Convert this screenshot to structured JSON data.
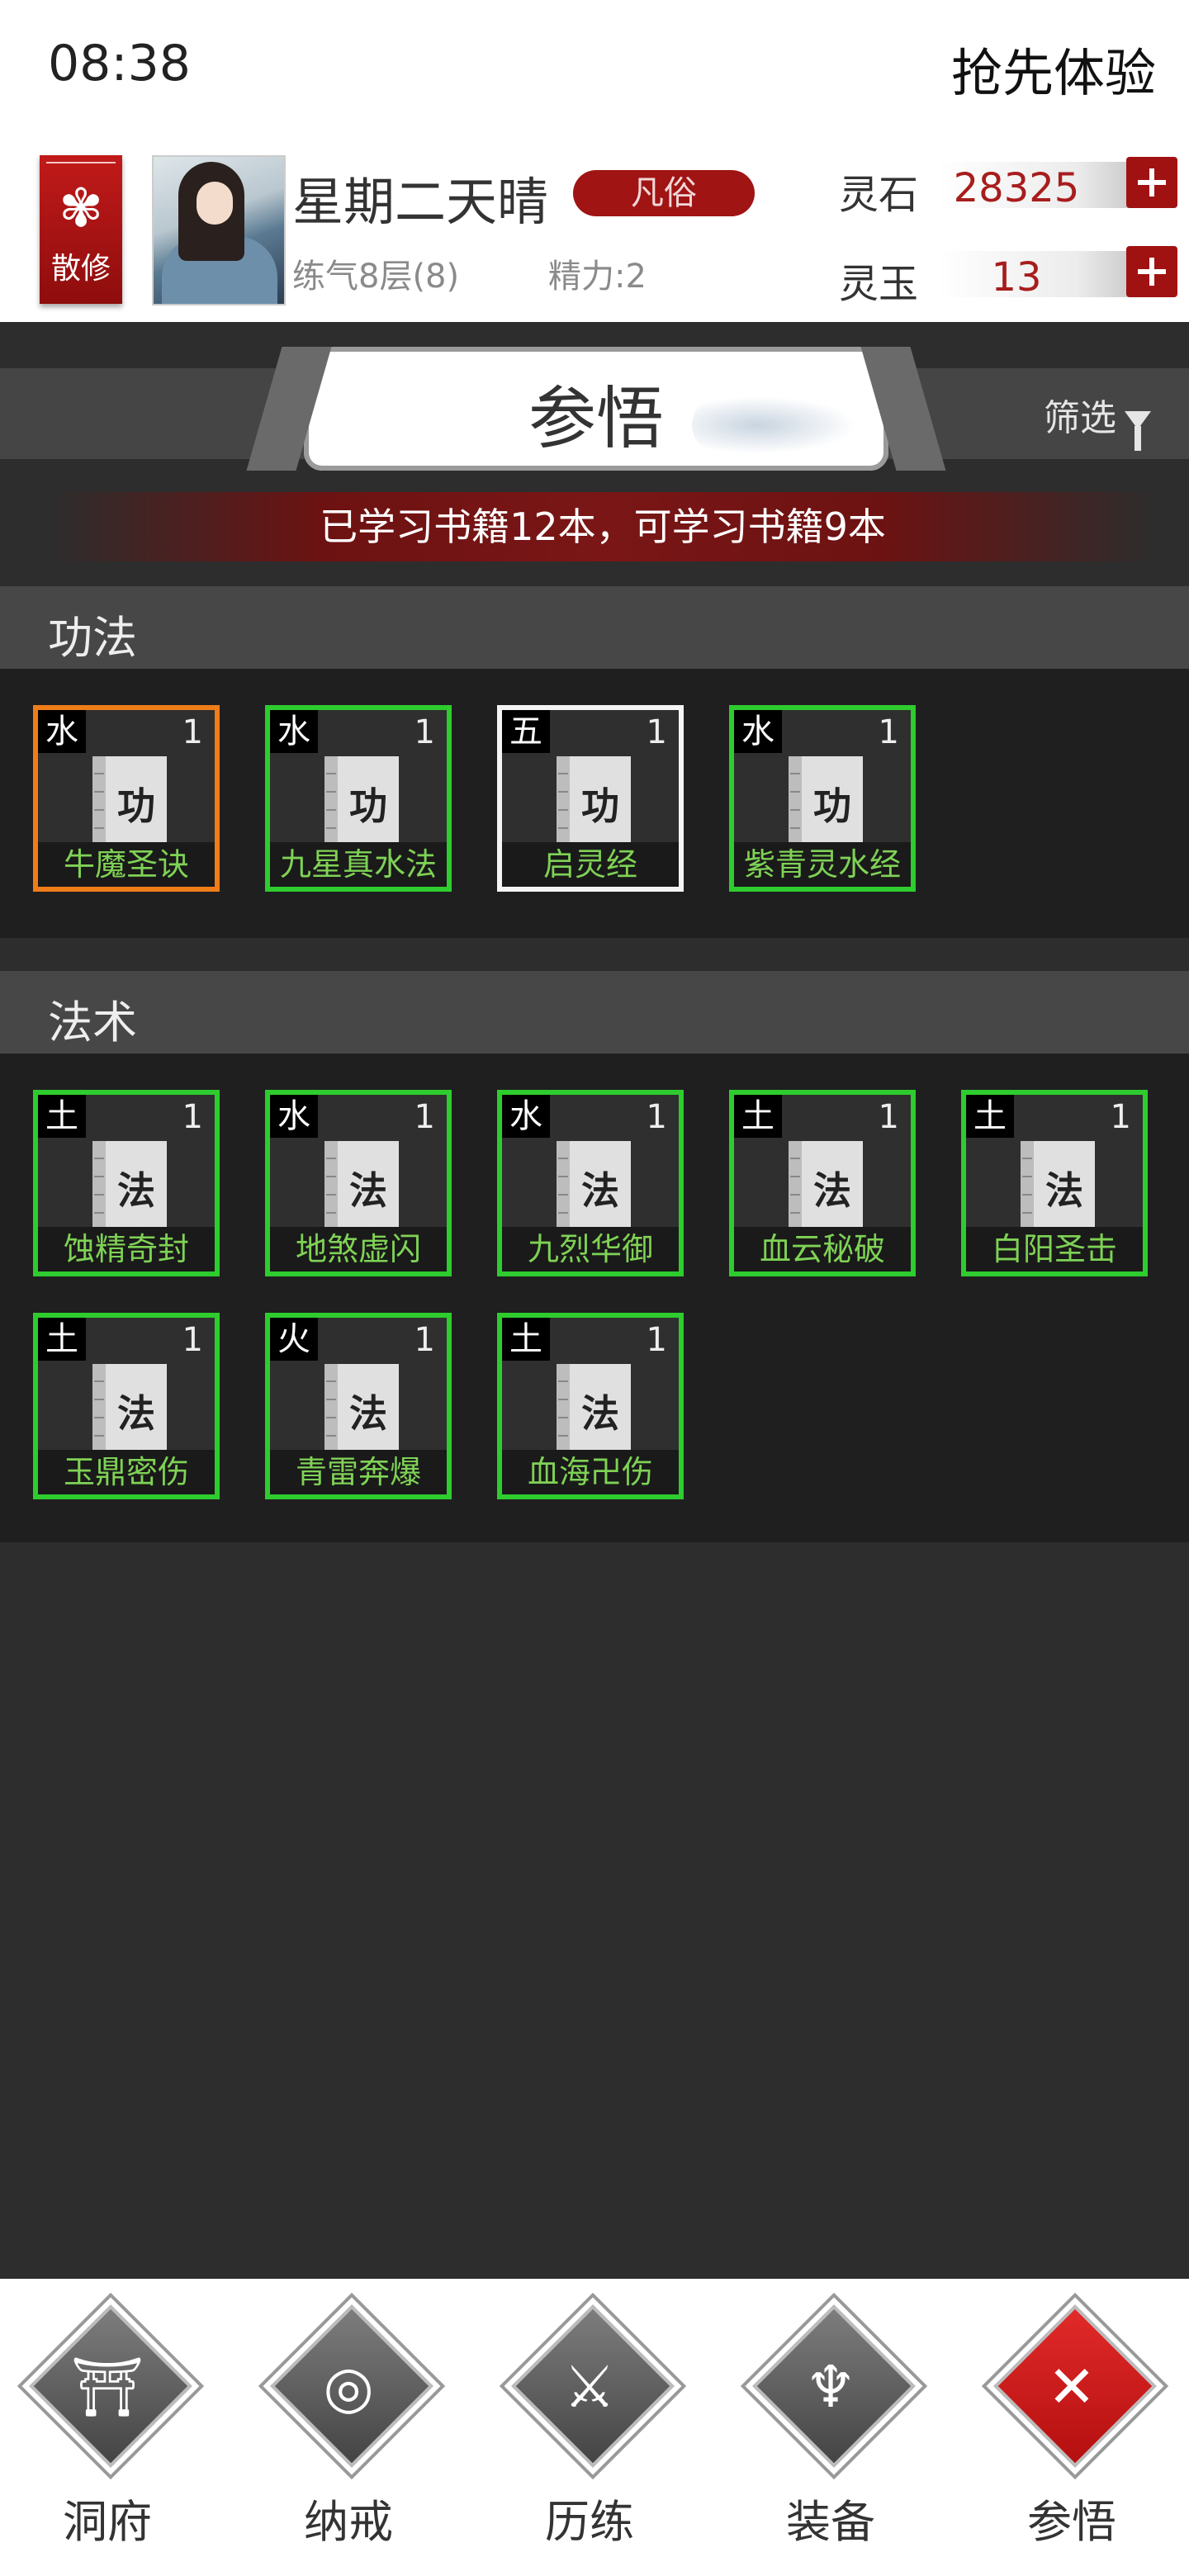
{
  "status_bar": {
    "time": "08:38",
    "action": "抢先体验"
  },
  "player": {
    "sect": "散修",
    "name": "星期二天晴",
    "rank": "凡俗",
    "cultivation": "练气8层(8)",
    "energy": "精力:2",
    "currencies": [
      {
        "label": "灵石",
        "value": "28325"
      },
      {
        "label": "灵玉",
        "value": "13"
      }
    ]
  },
  "page": {
    "title": "参悟",
    "filter_label": "筛选",
    "books_count": "已学习书籍12本，可学习书籍9本"
  },
  "sections": [
    {
      "title": "功法",
      "books": [
        {
          "element": "水",
          "level": "1",
          "glyph": "功",
          "name": "牛魔圣诀",
          "rarity": "orange"
        },
        {
          "element": "水",
          "level": "1",
          "glyph": "功",
          "name": "九星真水法",
          "rarity": "green"
        },
        {
          "element": "五",
          "level": "1",
          "glyph": "功",
          "name": "启灵经",
          "rarity": "white"
        },
        {
          "element": "水",
          "level": "1",
          "glyph": "功",
          "name": "紫青灵水经",
          "rarity": "green"
        }
      ]
    },
    {
      "title": "法术",
      "books": [
        {
          "element": "土",
          "level": "1",
          "glyph": "法",
          "name": "蚀精奇封",
          "rarity": "green"
        },
        {
          "element": "水",
          "level": "1",
          "glyph": "法",
          "name": "地煞虚闪",
          "rarity": "green"
        },
        {
          "element": "水",
          "level": "1",
          "glyph": "法",
          "name": "九烈华御",
          "rarity": "green"
        },
        {
          "element": "土",
          "level": "1",
          "glyph": "法",
          "name": "血云秘破",
          "rarity": "green"
        },
        {
          "element": "土",
          "level": "1",
          "glyph": "法",
          "name": "白阳圣击",
          "rarity": "green"
        },
        {
          "element": "土",
          "level": "1",
          "glyph": "法",
          "name": "玉鼎密伤",
          "rarity": "green"
        },
        {
          "element": "火",
          "level": "1",
          "glyph": "法",
          "name": "青雷奔爆",
          "rarity": "green"
        },
        {
          "element": "土",
          "level": "1",
          "glyph": "法",
          "name": "血海卍伤",
          "rarity": "green"
        }
      ]
    }
  ],
  "bottom_nav": [
    {
      "label": "洞府",
      "icon": "gate-icon",
      "glyph": "⛩"
    },
    {
      "label": "纳戒",
      "icon": "ring-icon",
      "glyph": "◎"
    },
    {
      "label": "历练",
      "icon": "crossed-swords-icon",
      "glyph": "⚔"
    },
    {
      "label": "装备",
      "icon": "dagger-icon",
      "glyph": "♆"
    },
    {
      "label": "参悟",
      "icon": "close-icon",
      "glyph": "✕",
      "active": true
    }
  ],
  "colors": {
    "accent_red": "#a01414",
    "book_green": "#2ecc2e",
    "book_orange": "#ef7d18",
    "book_white": "#f4f4f4"
  }
}
